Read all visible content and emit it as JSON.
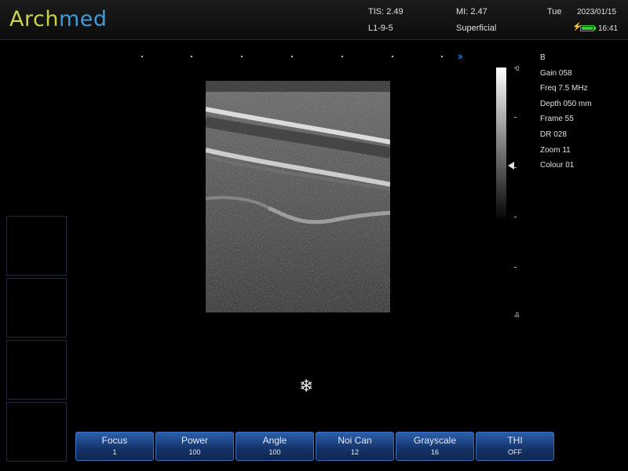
{
  "header": {
    "logo_part1": "Arch",
    "logo_part2": "med",
    "tis": "TIS: 2.49",
    "mi": "MI: 2.47",
    "day": "Tue",
    "date": "2023/01/15",
    "probe": "L1-9-5",
    "preset": "Superficial",
    "time": "16:41",
    "battery_level": 1.0
  },
  "mode": "B",
  "params": {
    "gain": "Gain  058",
    "freq": "Freq  7.5 MHz",
    "depth": "Depth  050 mm",
    "frame": "Frame  55",
    "dr": "DR  028",
    "zoom": "Zoom  11",
    "colour": "Colour  01"
  },
  "depth_scale": {
    "top": "0",
    "bottom": "5"
  },
  "icons": {
    "freeze": "snowflake-icon",
    "direction": "double-chevron-right-icon",
    "power": "plug-icon",
    "battery": "battery-icon"
  },
  "softkeys": [
    {
      "label": "Focus",
      "value": "1"
    },
    {
      "label": "Power",
      "value": "100"
    },
    {
      "label": "Angle",
      "value": "100"
    },
    {
      "label": "Noi Can",
      "value": "12"
    },
    {
      "label": "Grayscale",
      "value": "16"
    },
    {
      "label": "THI",
      "value": "OFF"
    }
  ],
  "colors": {
    "softkey": "#1a3f80",
    "logo_green": "#c9d34b",
    "logo_blue": "#3e9bd8",
    "chevron": "#3a8fe0"
  }
}
